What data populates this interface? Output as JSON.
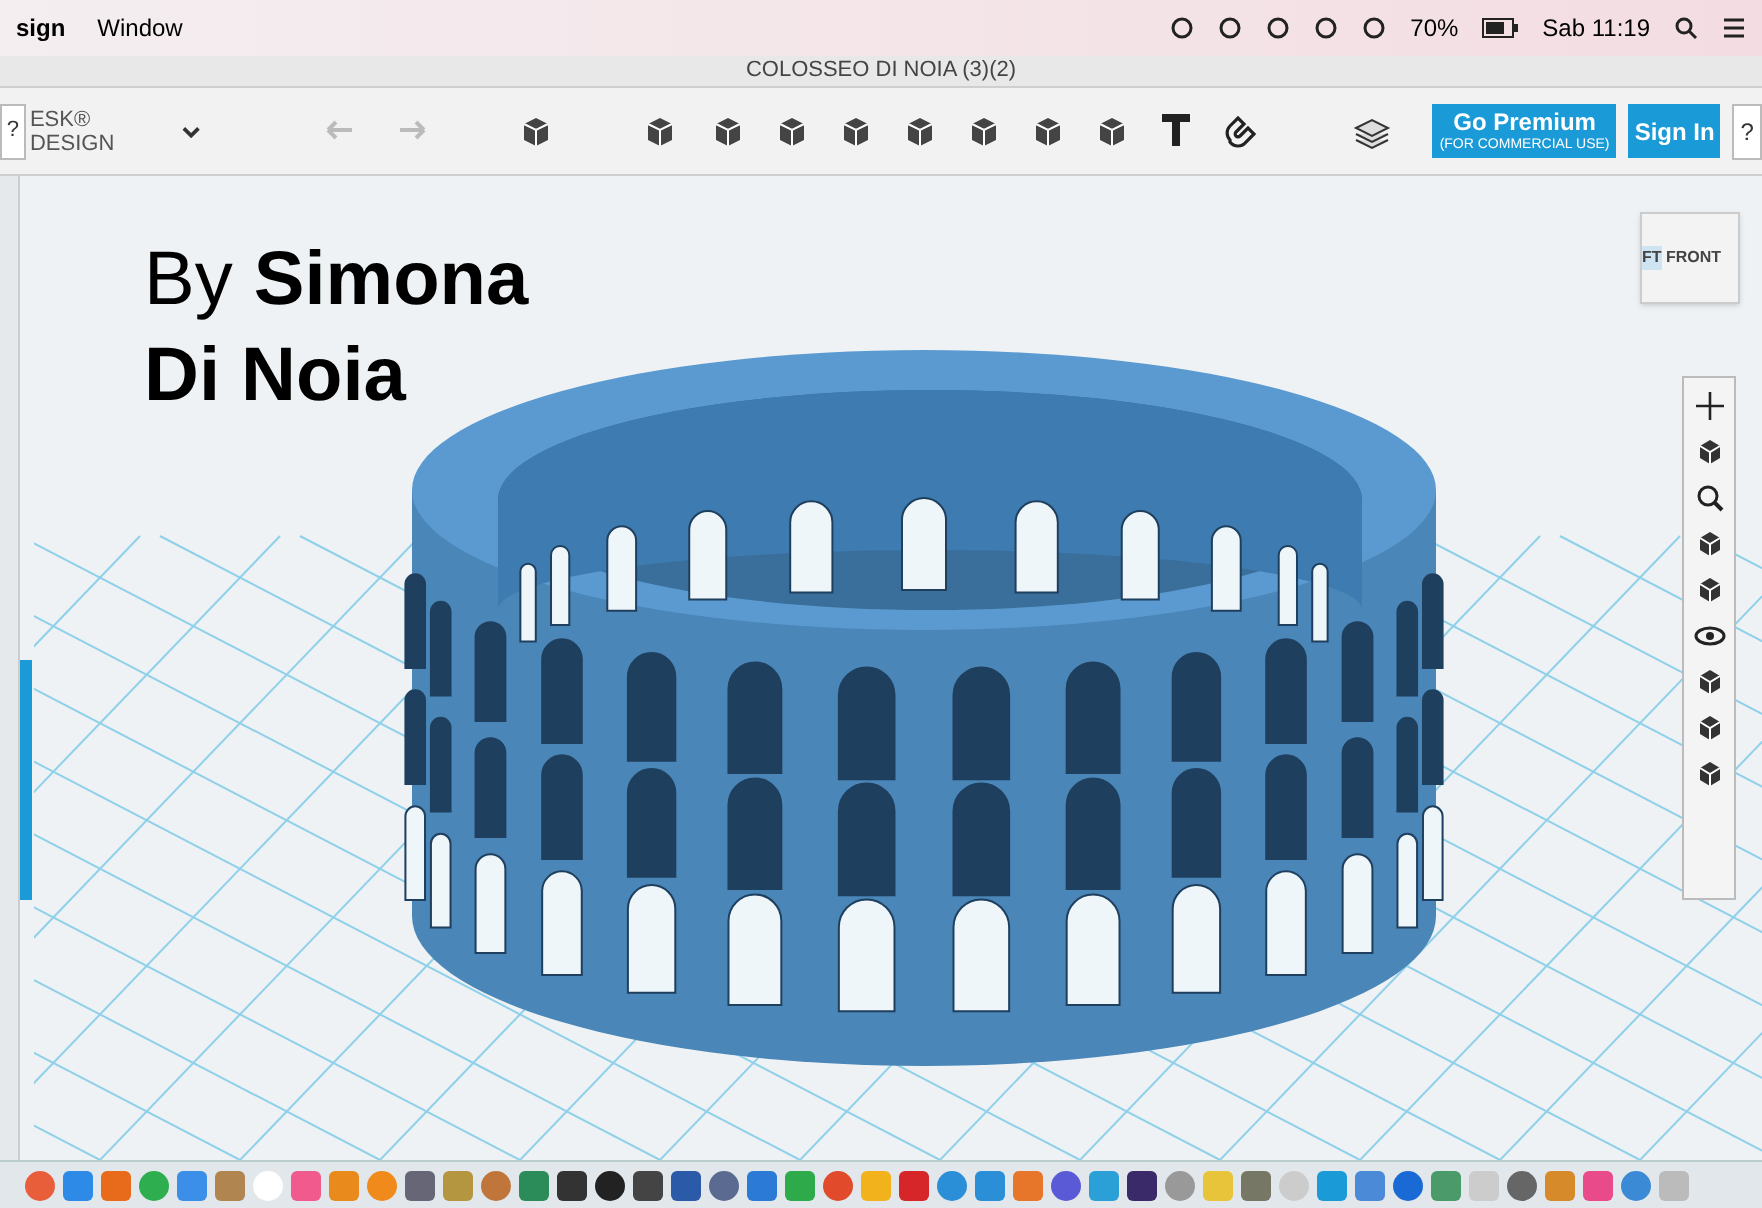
{
  "menu_bar": {
    "items": [
      "sign",
      "Window"
    ],
    "battery": "70%",
    "clock": "Sab 11:19"
  },
  "window": {
    "title": "COLOSSEO DI NOIA (3)(2)"
  },
  "toolbar": {
    "logo": [
      "ESK®",
      "DESIGN"
    ],
    "premium_button": {
      "label": "Go Premium",
      "sublabel": "(FOR COMMERCIAL USE)"
    },
    "sign_in": "Sign In",
    "help": "?",
    "left_help": "?"
  },
  "viewport": {
    "caption": "By **Simona** **Di Noia**",
    "view_cube": [
      "FT",
      "FRONT"
    ]
  }
}
